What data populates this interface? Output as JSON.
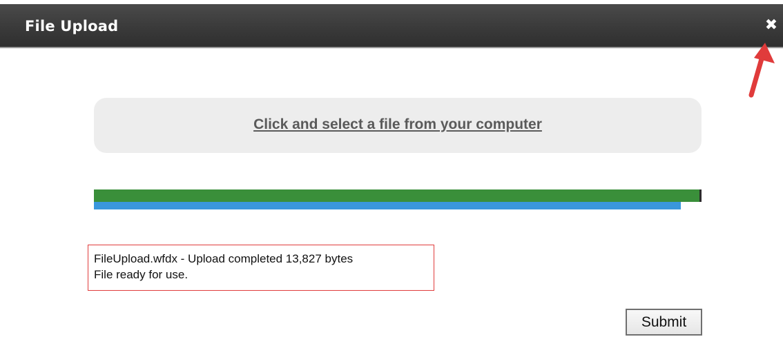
{
  "dialog": {
    "title": "File Upload",
    "close_icon": "close-icon",
    "close_glyph": "✖"
  },
  "dropzone": {
    "link_text": "Click and select a file from your computer"
  },
  "progress": {
    "upload_fraction": 1.0,
    "secondary_fraction": 0.968,
    "upload_color": "#3a8f3a",
    "secondary_color": "#3a97dc"
  },
  "status": {
    "line1": "FileUpload.wfdx - Upload completed 13,827 bytes",
    "line2": "File ready for use.",
    "border_color": "#e03b3b"
  },
  "actions": {
    "submit_label": "Submit"
  },
  "annotation": {
    "icon": "red-arrow-icon",
    "color": "#e03b3b"
  }
}
